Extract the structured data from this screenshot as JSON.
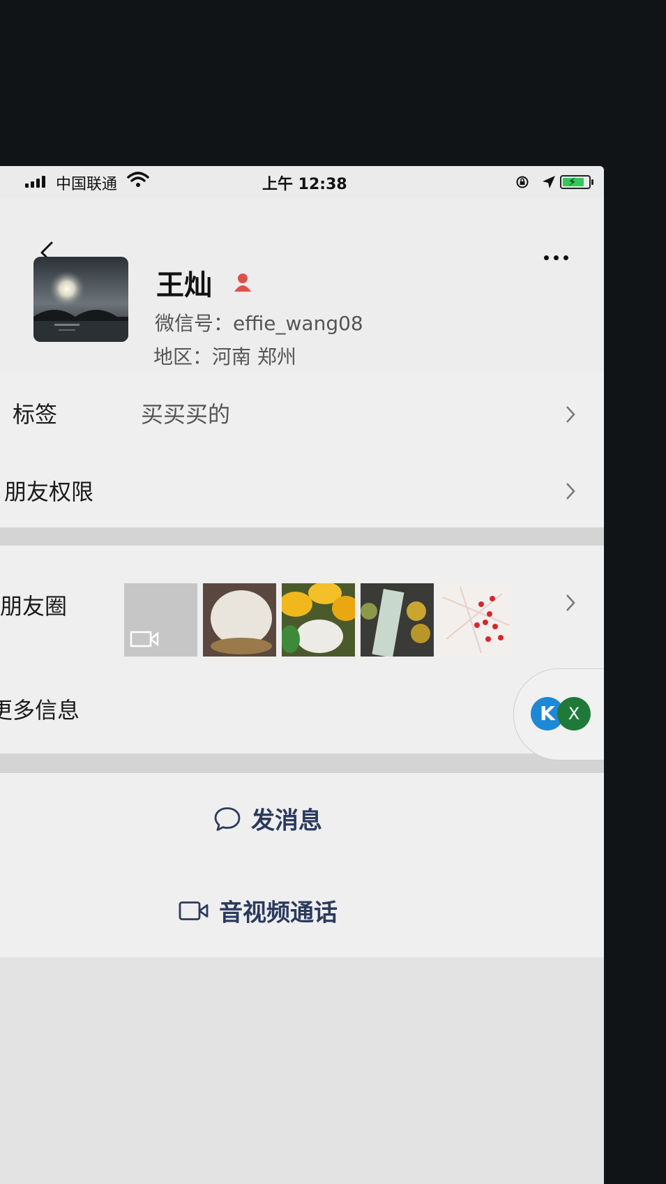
{
  "status_bar": {
    "carrier": "中国联通",
    "time": "上午 12:38"
  },
  "profile": {
    "name": "王灿",
    "wechat_id": "微信号：effie_wang08",
    "region": "地区：河南 郑州"
  },
  "rows": {
    "tags_label": "标签",
    "tags_value": "买买买的",
    "permissions_label": "朋友权限",
    "moments_label": "朋友圈",
    "more_info_label": "更多信息"
  },
  "actions": {
    "message_label": "发消息",
    "call_label": "音视频通话"
  },
  "floating": {
    "k_label": "K",
    "x_label": "X"
  },
  "colors": {
    "accent_text": "#2b3a5e",
    "battery": "#34c759",
    "gender": "#e0504a"
  }
}
